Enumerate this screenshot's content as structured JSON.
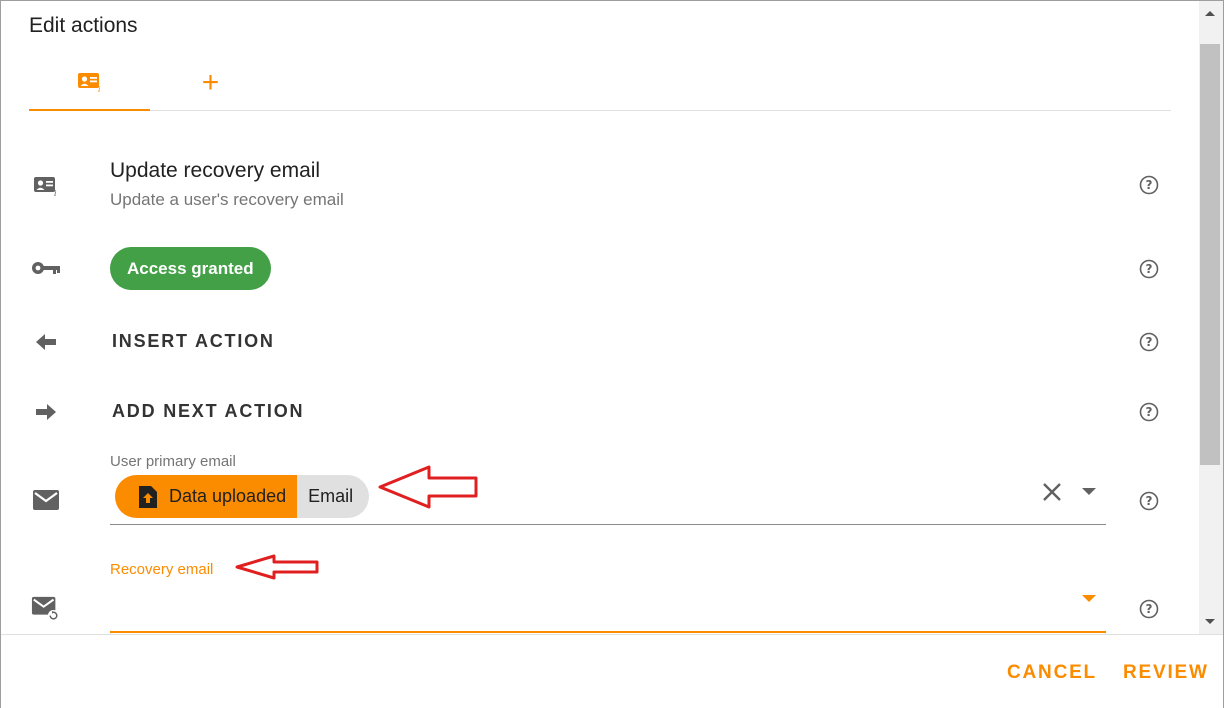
{
  "dialog": {
    "title": "Edit actions"
  },
  "tabs": [
    {
      "icon": "contact-card-icon",
      "active": true
    },
    {
      "icon": "plus-icon",
      "label": "+",
      "active": false
    }
  ],
  "action": {
    "title": "Update recovery email",
    "subtitle": "Update a user's recovery email"
  },
  "access": {
    "label": "Access granted",
    "color": "#43a047"
  },
  "buttons": {
    "insert": "INSERT ACTION",
    "add_next": "ADD NEXT ACTION"
  },
  "fields": {
    "primary_email": {
      "label": "User primary email",
      "chip_source": "Data uploaded",
      "chip_value": "Email"
    },
    "recovery_email": {
      "label": "Recovery email",
      "value": ""
    }
  },
  "footer": {
    "cancel": "CANCEL",
    "review": "REVIEW"
  },
  "colors": {
    "accent": "#fb8c00",
    "success": "#43a047",
    "annotation": "#e02020"
  }
}
